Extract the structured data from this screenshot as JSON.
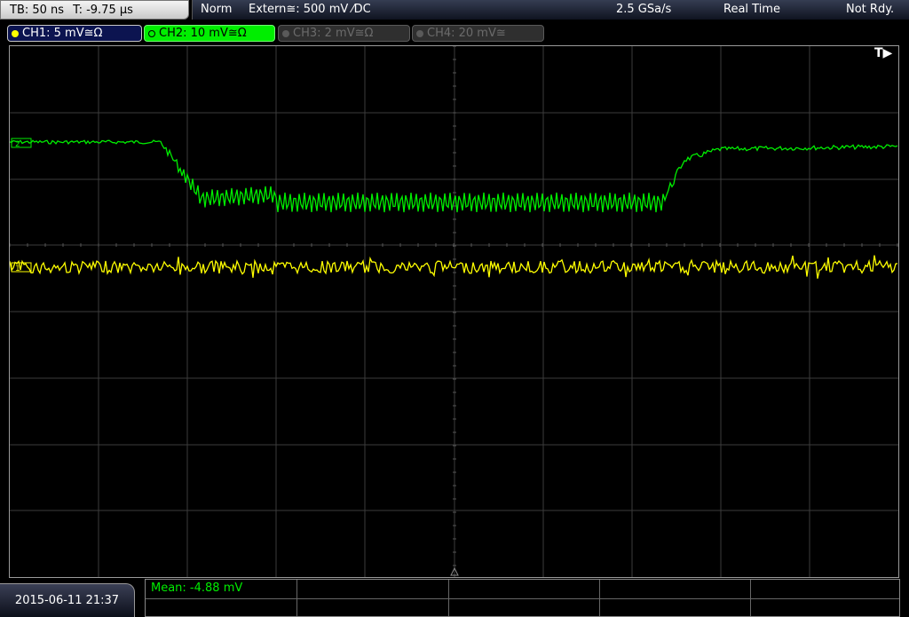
{
  "header": {
    "timebase": "TB: 50 ns",
    "trigger_time": "T: -9.75 μs",
    "trigger_mode": "Norm",
    "trigger_source": "Extern≅: 500 mV ⁄DC",
    "sample_rate": "2.5 GSa/s",
    "acq_mode": "Real Time",
    "status": "Not Rdy."
  },
  "channels": [
    {
      "label": "CH1: 5 mV≅Ω",
      "state": "on",
      "color": "#ffff00"
    },
    {
      "label": "CH2: 10 mV≅Ω",
      "state": "selected",
      "color": "#00ee00"
    },
    {
      "label": "CH3: 2 mV≅Ω",
      "state": "off",
      "color": "#5a5a5a"
    },
    {
      "label": "CH4: 20 mV≅",
      "state": "off",
      "color": "#5a5a5a"
    }
  ],
  "trigger_marker": "T▶",
  "footer": {
    "datetime": "2015-06-11 21:37",
    "measurement": "Mean: -4.88 mV"
  },
  "colors": {
    "ch1": "#ffff00",
    "ch2": "#00ee00",
    "grid": "#3c3c3c",
    "background": "#000000"
  }
}
